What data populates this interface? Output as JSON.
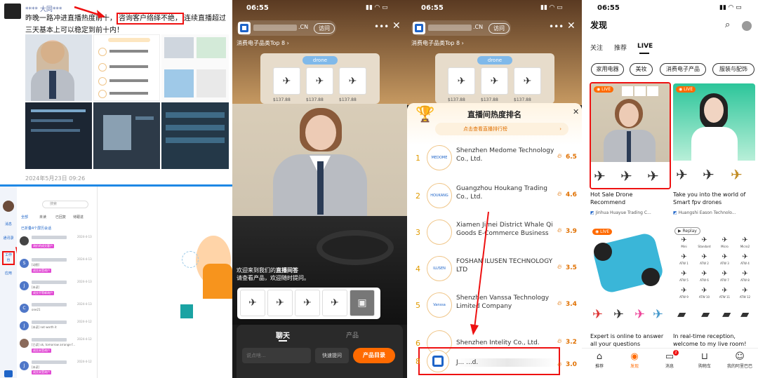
{
  "panel1": {
    "post": {
      "author": "**** 大同***",
      "text_before": "昨晚一路冲进直播热度前十，",
      "text_highlight": "咨询客户络绎不绝，",
      "text_after": "连续直播超过三天基本上可以稳定到前十内！",
      "date": "2024年5月23日 09:26"
    },
    "chat_app": {
      "search_placeholder": "搜索",
      "rail": [
        "消息",
        "通讯录",
        "工作台",
        "应用"
      ],
      "tabs": [
        "全部",
        "未读",
        "已回复",
        "待跟进"
      ],
      "folder_label": "已折叠4个屏历会话",
      "rows": [
        {
          "avatar": "",
          "time": "2024-4-13",
          "msg": "",
          "badge": "询价的成交客户"
        },
        {
          "avatar": "S",
          "time": "2024-4-13",
          "msg": "[动图]",
          "badge": "成交未受询户"
        },
        {
          "avatar": "J",
          "time": "2024-4-13",
          "msg": "[未读]",
          "badge": "成交不等邮询户"
        },
        {
          "avatar": "C",
          "time": "2024-4-13",
          "msg": "one21",
          "badge": ""
        },
        {
          "avatar": "J",
          "time": "2024-4-12",
          "msg": "[未读] not worth it",
          "badge": ""
        },
        {
          "avatar": "",
          "time": "2024-4-12",
          "msg": "[已读] ok, tomorrow arrange f...",
          "badge": "成交未受询户"
        },
        {
          "avatar": "J",
          "time": "2024-4-12",
          "msg": "[未读]",
          "badge": "成交未受询户"
        }
      ]
    }
  },
  "panel2": {
    "time": "06:55",
    "domain": ".CN",
    "visit": "访问",
    "category_rank": "消费电子品类Top 8",
    "shelf_label": "drone",
    "prices": [
      "$137.88",
      "$137.88",
      "$137.88"
    ],
    "welcome_1": "欢迎来到我们的",
    "welcome_bold": "直播间答",
    "welcome_2": "请查看产品，欢迎随时提问。",
    "tab_chat": "聊天",
    "tab_products": "产品",
    "input_placeholder": "说点啥...",
    "quick_btn": "快速提问",
    "catalog_btn": "产品目录"
  },
  "panel3": {
    "time": "06:55",
    "domain": ".CN",
    "visit": "访问",
    "category_rank": "消费电子品类Top 8",
    "shelf_label": "drone",
    "prices": [
      "$137.88",
      "$137.88",
      "$137.88"
    ],
    "rank_title": "直播间热度排名",
    "rank_sub": "点击查看直播排行榜",
    "rows": [
      {
        "num": "1",
        "name": "Shenzhen Medome Technology Co., Ltd.",
        "score": "6.5",
        "logo": "MEDOME"
      },
      {
        "num": "2",
        "name": "Guangzhou Houkang Trading Co., Ltd.",
        "score": "4.6",
        "logo": "HOUKANG"
      },
      {
        "num": "3",
        "name": "Xiamen Jimei District Whale Qi Goods E-Commerce Business",
        "score": "3.9",
        "logo": ""
      },
      {
        "num": "4",
        "name": "FOSHAN ILUSEN TECHNOLOGY LTD",
        "score": "3.5",
        "logo": "ILUSEN"
      },
      {
        "num": "5",
        "name": "Shenzhen Vanssa Technology Limited Company",
        "score": "3.4",
        "logo": "Vanssa"
      },
      {
        "num": "6",
        "name": "Shenzhen Intelity Co., Ltd.",
        "score": "3.2",
        "logo": ""
      },
      {
        "num": "8",
        "name": "J...                  ...d.",
        "score": "3.0",
        "logo": ""
      }
    ]
  },
  "panel4": {
    "time": "06:55",
    "title": "发现",
    "tabs": [
      "关注",
      "推荐",
      "LIVE"
    ],
    "categories": [
      "家用电器",
      "美妆",
      "消费电子产品",
      "服装与配饰"
    ],
    "live_badge": "LIVE",
    "replay_badge": "Replay",
    "cards": [
      {
        "title": "Hot Sale Drone Recommend",
        "shop": "Jinhua Huayue Trading C..."
      },
      {
        "title": "Take you into the world of Smart fpv drones",
        "shop": "Huangshi Eason Technolo..."
      },
      {
        "title": "Expert is online to answer all your questions",
        "shop": ""
      },
      {
        "title": "In real-time reception, welcome to my live room!",
        "shop": ""
      }
    ],
    "spec_labels": [
      "Mini",
      "Standard",
      "Micro",
      "Micro2",
      "ATW 1",
      "ATW 2",
      "ATW 3",
      "ATW 4",
      "ATW 5",
      "ATW 6",
      "ATW 7",
      "ATW 8",
      "ATW 9",
      "ATW 10",
      "ATW 11",
      "ATW 12"
    ],
    "nav": [
      "推荐",
      "发现",
      "消息",
      "购物车",
      "我的阿里巴巴"
    ],
    "msg_count": "2"
  },
  "colors": {
    "accent_orange": "#ff6a00",
    "highlight_red": "#e11111",
    "brand_blue": "#1e88e5"
  }
}
